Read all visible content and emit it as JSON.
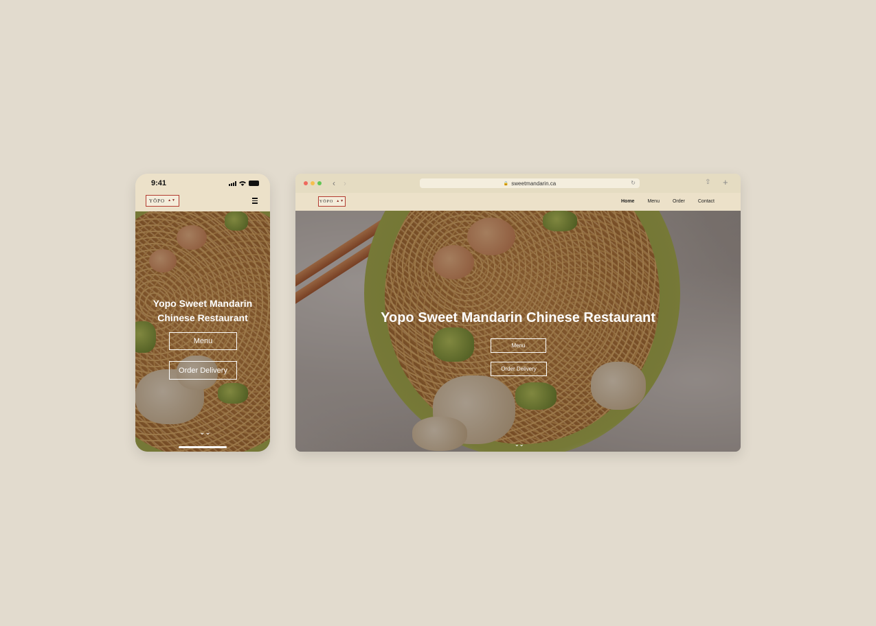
{
  "phone": {
    "status_time": "9:41",
    "logo_text": "YŌPO",
    "logo_mark": "▲▼",
    "menu_icon": "hamburger-icon",
    "hero_title": "Yopo Sweet Mandarin Chinese Restaurant",
    "menu_button": "Menu",
    "order_button": "Order Delivery",
    "scroll_icon": "double-chevron-down-icon",
    "scroll_glyph": "⌄⌄"
  },
  "browser": {
    "url": "sweetmandarin.ca",
    "traffic_lights": [
      "#ee6a5e",
      "#f5bf4f",
      "#61c554"
    ],
    "back_glyph": "‹",
    "forward_glyph": "›",
    "share_glyph": "⇧",
    "newtab_glyph": "+",
    "reload_glyph": "↻",
    "lock_glyph": "🔒",
    "logo_text": "YŌPO",
    "logo_mark": "▲▼",
    "nav": [
      "Home",
      "Menu",
      "Order",
      "Contact"
    ],
    "active_nav": "Home",
    "hero_title": "Yopo Sweet Mandarin Chinese Restaurant",
    "menu_button": "Menu",
    "order_button": "Order Delivery",
    "scroll_glyph": "⌄⌄"
  },
  "colors": {
    "background": "#e2dbce",
    "header": "#ece1c9",
    "logo_border": "#b23a2f"
  }
}
